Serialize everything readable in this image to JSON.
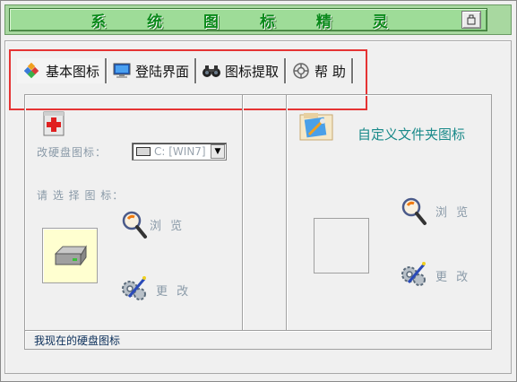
{
  "app": {
    "title": "系 统 图 标 精 灵",
    "close_glyph": "□"
  },
  "tabs": [
    {
      "label": "基本图标",
      "icon": "colorful-diamond-icon",
      "active": true
    },
    {
      "label": "登陆界面",
      "icon": "monitor-icon",
      "active": false
    },
    {
      "label": "图标提取",
      "icon": "binoculars-icon",
      "active": false
    },
    {
      "label": "帮 助",
      "icon": "lifebuoy-icon",
      "active": false
    }
  ],
  "left_panel": {
    "drive_label": "改硬盘图标：",
    "drive_select_value": "C: [WIN7]",
    "choose_label": "请 选 择 图 标：",
    "browse_label": "浏 览",
    "change_label": "更 改"
  },
  "right_panel": {
    "title": "自定义文件夹图标",
    "browse_label": "浏 览",
    "change_label": "更 改"
  },
  "status": {
    "text": "我现在的硬盘图标"
  },
  "colors": {
    "title_bg": "#9edc98",
    "title_text": "#0a8a1a",
    "highlight_box": "#e53333",
    "teal_text": "#1a8a8a"
  }
}
